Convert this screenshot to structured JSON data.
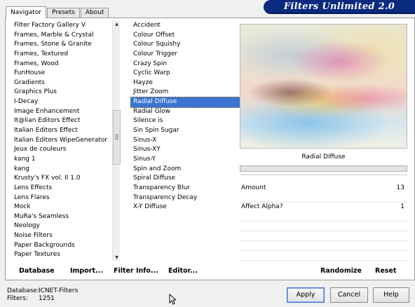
{
  "banner": {
    "title": "Filters Unlimited 2.0"
  },
  "tabs": [
    {
      "label": "Navigator",
      "active": true
    },
    {
      "label": "Presets",
      "active": false
    },
    {
      "label": "About",
      "active": false
    }
  ],
  "categories": [
    "Filter Factory Gallery V",
    "Frames, Marble & Crystal",
    "Frames, Stone & Granite",
    "Frames, Textured",
    "Frames, Wood",
    "FunHouse",
    "Gradients",
    "Graphics Plus",
    "I-Decay",
    "Image Enhancement",
    "It@lian Editors Effect",
    "Italian Editors Effect",
    "Italian Editors WipeGenerator",
    "Jeux de couleurs",
    "kang 1",
    "kang",
    "Krusty's FX vol. II 1.0",
    "Lens Effects",
    "Lens Flares",
    "Mock",
    "MuRa's Seamless",
    "Neology",
    "Noise Filters",
    "Paper Backgrounds",
    "Paper Textures"
  ],
  "filters": [
    "Accident",
    "Colour Offset",
    "Colour Squishy",
    "Colour Trigger",
    "Crazy Spin",
    "Cyclic Warp",
    "Hayze",
    "Jitter Zoom",
    "Radial Diffuse",
    "Radial Glow",
    "Silence is",
    "Sin Spin Sugar",
    "Sinus-X",
    "Sinus-XY",
    "Sinus-Y",
    "Spin and Zoom",
    "Spiral Diffuse",
    "Transparency Blur",
    "Transparency Decay",
    "X-Y Diffuse"
  ],
  "selected_filter_index": 8,
  "preview": {
    "filter_name": "Radial Diffuse"
  },
  "params": [
    {
      "label": "Amount",
      "value": "13"
    },
    {
      "label": "Affect Alpha?",
      "value": "1"
    }
  ],
  "bottom_bar": {
    "database": "Database",
    "import": "Import...",
    "filter_info": "Filter Info...",
    "editor": "Editor...",
    "randomize": "Randomize",
    "reset": "Reset"
  },
  "status": {
    "database_label": "Database:",
    "database_value": "ICNET-Filters",
    "filters_label": "Filters:",
    "filters_value": "1251"
  },
  "buttons": {
    "apply": "Apply",
    "cancel": "Cancel",
    "help": "Help"
  },
  "colors": {
    "banner": "#0a2a80",
    "selection": "#3b74d0"
  }
}
